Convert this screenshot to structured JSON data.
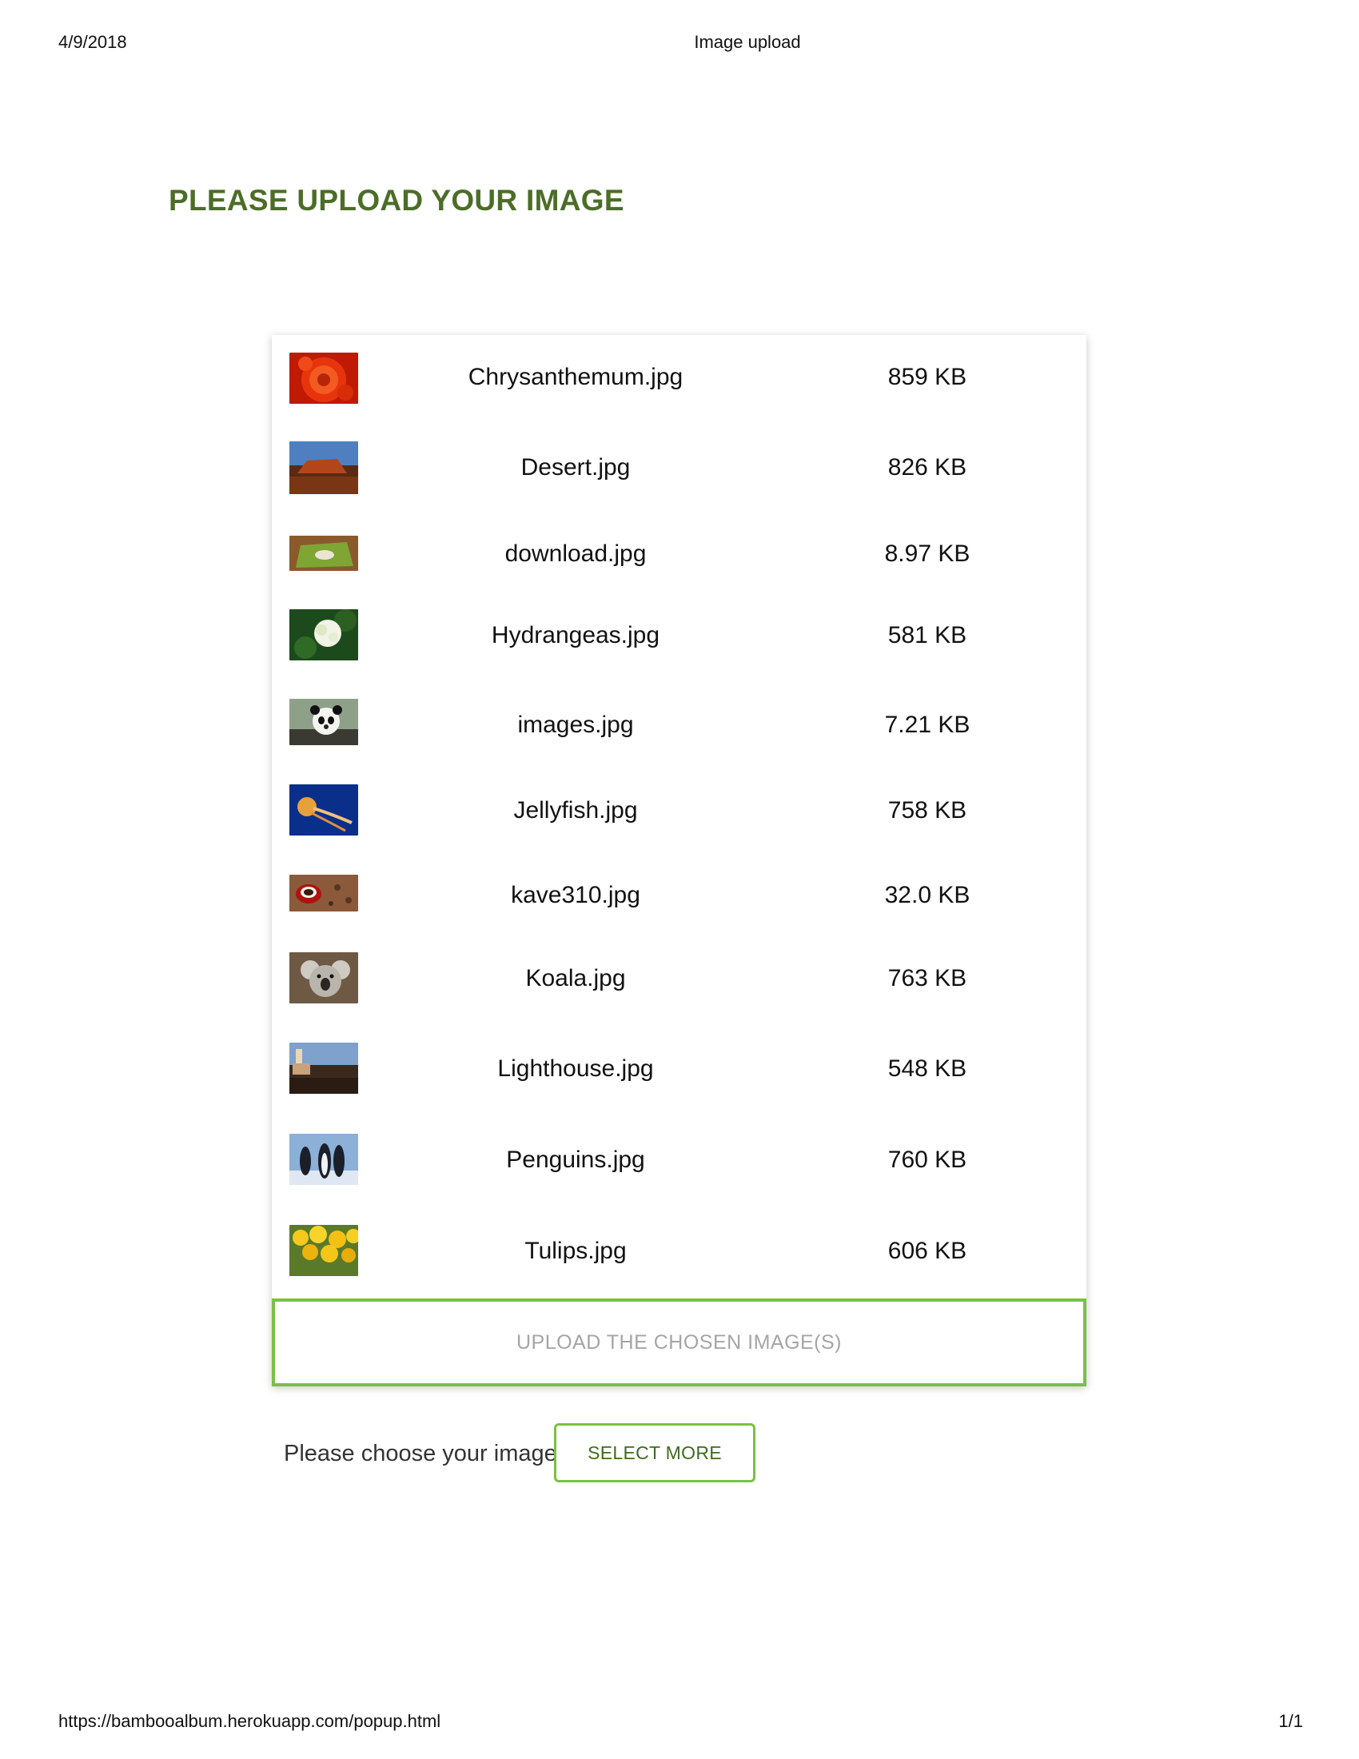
{
  "print_header": {
    "date": "4/9/2018",
    "title": "Image upload"
  },
  "heading": "PLEASE UPLOAD YOUR IMAGE",
  "files": [
    {
      "name": "Chrysanthemum.jpg",
      "size": "859 KB",
      "thumb": "chrysanthemum-photo"
    },
    {
      "name": "Desert.jpg",
      "size": "826 KB",
      "thumb": "desert-photo"
    },
    {
      "name": "download.jpg",
      "size": "8.97 KB",
      "thumb": "field-photo"
    },
    {
      "name": "Hydrangeas.jpg",
      "size": "581 KB",
      "thumb": "hydrangeas-photo"
    },
    {
      "name": "images.jpg",
      "size": "7.21 KB",
      "thumb": "panda-photo"
    },
    {
      "name": "Jellyfish.jpg",
      "size": "758 KB",
      "thumb": "jellyfish-photo"
    },
    {
      "name": "kave310.jpg",
      "size": "32.0 KB",
      "thumb": "coffee-photo"
    },
    {
      "name": "Koala.jpg",
      "size": "763 KB",
      "thumb": "koala-photo"
    },
    {
      "name": "Lighthouse.jpg",
      "size": "548 KB",
      "thumb": "lighthouse-photo"
    },
    {
      "name": "Penguins.jpg",
      "size": "760 KB",
      "thumb": "penguins-photo"
    },
    {
      "name": "Tulips.jpg",
      "size": "606 KB",
      "thumb": "tulips-photo"
    }
  ],
  "upload_button": "UPLOAD THE CHOSEN IMAGE(S)",
  "choose_label": "Please choose your image",
  "select_more_button": "SELECT MORE",
  "print_footer": {
    "url": "https://bambooalbum.herokuapp.com/popup.html",
    "page": "1/1"
  },
  "colors": {
    "heading": "#4c6d27",
    "accent_border": "#7ac143",
    "button_text": "#3f6b1e"
  }
}
